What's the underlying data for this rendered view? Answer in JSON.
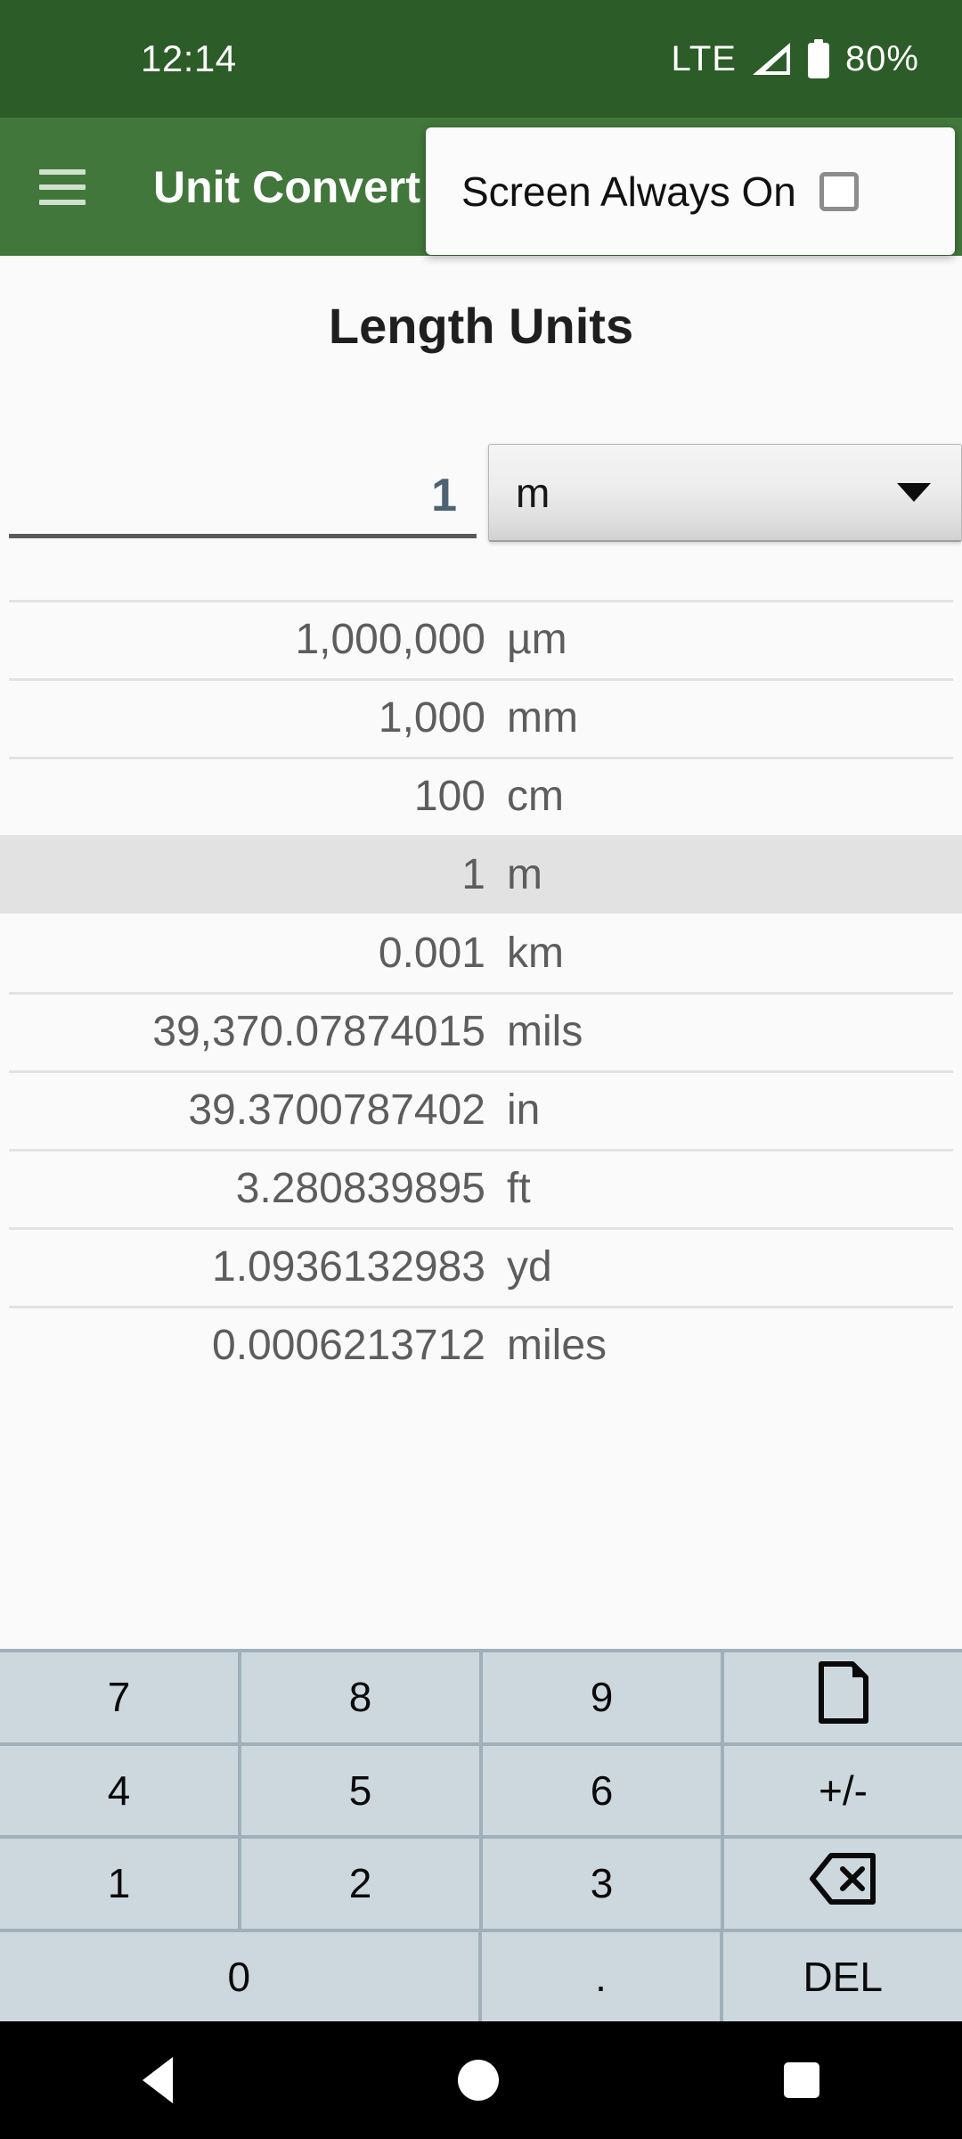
{
  "status_bar": {
    "time": "12:14",
    "network": "LTE",
    "battery_percent": "80%",
    "signal_icon": "signal-triangle-icon",
    "battery_icon": "battery-icon"
  },
  "app_bar": {
    "title": "Unit Convert",
    "menu_icon": "hamburger-menu-icon",
    "accent_color": "#41773b",
    "status_bar_color": "#2c5c27"
  },
  "overflow_popup": {
    "item_label": "Screen Always On",
    "checked": false,
    "checkbox_icon": "checkbox-unchecked-icon"
  },
  "page": {
    "title": "Length Units"
  },
  "input": {
    "value": "1",
    "placeholder": "0",
    "value_color": "#4d6272",
    "unit": "m",
    "spinner_icon": "chevron-down-icon"
  },
  "conversions": [
    {
      "value": "1,000,000",
      "unit": "µm",
      "selected": false
    },
    {
      "value": "1,000",
      "unit": "mm",
      "selected": false
    },
    {
      "value": "100",
      "unit": "cm",
      "selected": false
    },
    {
      "value": "1",
      "unit": "m",
      "selected": true
    },
    {
      "value": "0.001",
      "unit": "km",
      "selected": false
    },
    {
      "value": "39,370.07874015",
      "unit": "mils",
      "selected": false
    },
    {
      "value": "39.3700787402",
      "unit": "in",
      "selected": false
    },
    {
      "value": "3.280839895",
      "unit": "ft",
      "selected": false
    },
    {
      "value": "1.0936132983",
      "unit": "yd",
      "selected": false
    },
    {
      "value": "0.0006213712",
      "unit": "miles",
      "selected": false
    }
  ],
  "keypad": {
    "background": "#9fb0bb",
    "key_color": "#cdd8de",
    "rows": [
      [
        {
          "label": "7",
          "name": "key-7",
          "icon": null
        },
        {
          "label": "8",
          "name": "key-8",
          "icon": null
        },
        {
          "label": "9",
          "name": "key-9",
          "icon": null
        },
        {
          "label": "",
          "name": "key-clear",
          "icon": "document-page-icon"
        }
      ],
      [
        {
          "label": "4",
          "name": "key-4",
          "icon": null
        },
        {
          "label": "5",
          "name": "key-5",
          "icon": null
        },
        {
          "label": "6",
          "name": "key-6",
          "icon": null
        },
        {
          "label": "+/-",
          "name": "key-sign-toggle",
          "icon": null
        }
      ],
      [
        {
          "label": "1",
          "name": "key-1",
          "icon": null
        },
        {
          "label": "2",
          "name": "key-2",
          "icon": null
        },
        {
          "label": "3",
          "name": "key-3",
          "icon": null
        },
        {
          "label": "",
          "name": "key-backspace",
          "icon": "backspace-icon"
        }
      ],
      [
        {
          "label": "0",
          "name": "key-0",
          "icon": null,
          "wide": true
        },
        {
          "label": ".",
          "name": "key-decimal",
          "icon": null
        },
        {
          "label": "DEL",
          "name": "key-del",
          "icon": null
        }
      ]
    ]
  },
  "nav_bar": {
    "back_icon": "back-triangle-icon",
    "home_icon": "home-circle-icon",
    "recents_icon": "recents-square-icon"
  }
}
